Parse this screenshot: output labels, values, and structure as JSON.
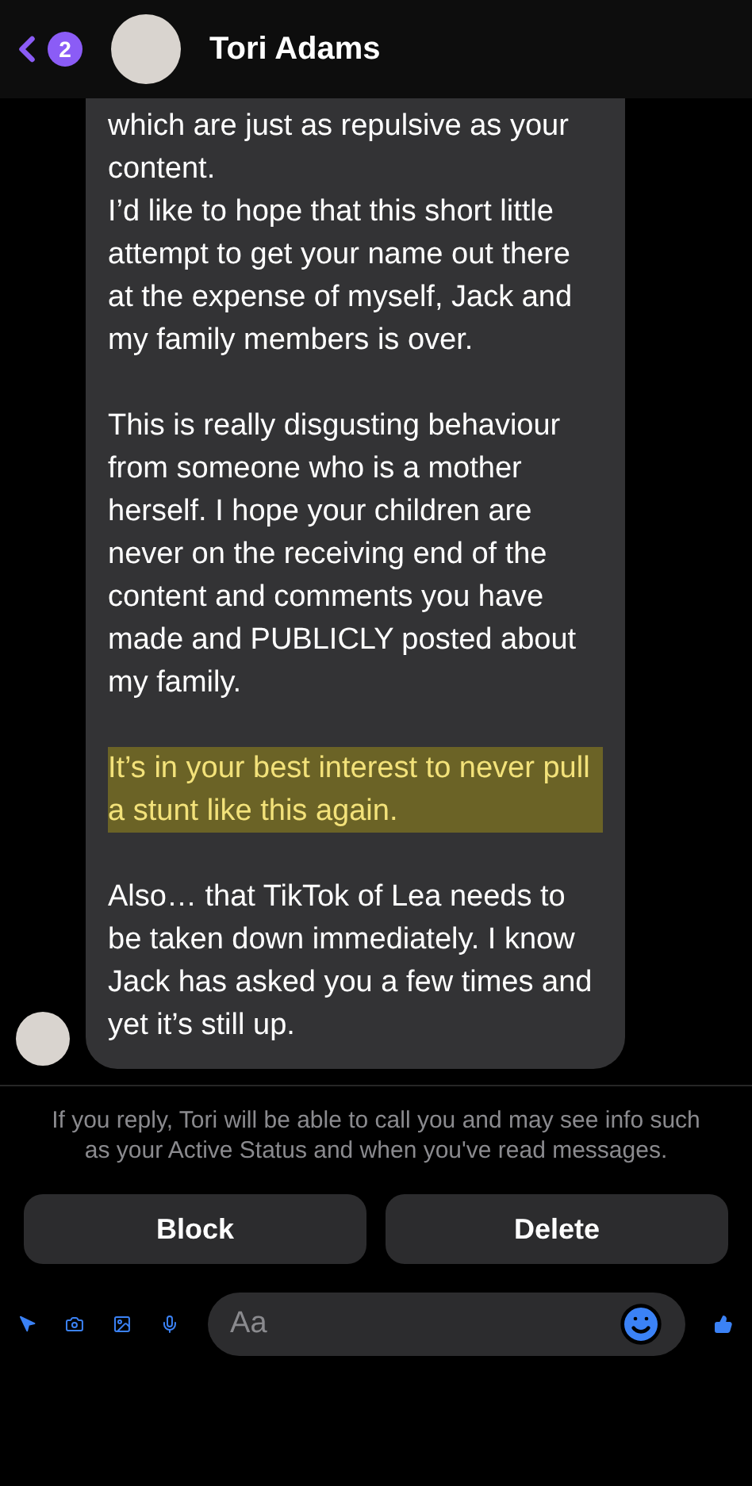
{
  "header": {
    "back_badge": "2",
    "name": "Tori Adams"
  },
  "message": {
    "paragraphs": [
      {
        "text": "which are just as repulsive as your content.\nI’d like to hope that this short little attempt to get your name out there at the expense of myself, Jack and my family members is over.",
        "highlighted": false
      },
      {
        "text": "This is really disgusting behaviour from someone who is a mother herself. I hope your children are never on the receiving end of the content and comments you have made and PUBLICLY posted about my family.",
        "highlighted": false
      },
      {
        "text": "It’s in your best interest to never pull a stunt like this again.",
        "highlighted": true
      },
      {
        "text": "Also… that TikTok of Lea needs to be taken down immediately. I know Jack has asked you a few times and yet it’s still up.",
        "highlighted": false
      }
    ]
  },
  "notice": "If you reply, Tori will be able to call you and may see info such as your Active Status and when you've read messages.",
  "buttons": [
    "Block",
    "Delete"
  ],
  "composer": {
    "placeholder": "Aa"
  }
}
